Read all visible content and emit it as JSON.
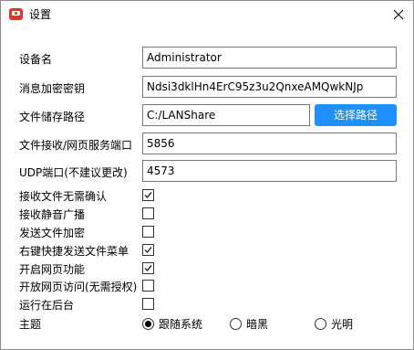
{
  "window": {
    "title": "设置",
    "icon": "app-screen-icon",
    "close_icon": "close-icon"
  },
  "form": {
    "device_name": {
      "label": "设备名",
      "value": "Administrator"
    },
    "encryption_key": {
      "label": "消息加密密钥",
      "value": "Ndsi3dklHn4ErC95z3u2QnxeAMQwkNJp"
    },
    "storage_path": {
      "label": "文件储存路径",
      "value": "C:/LANShare",
      "button": "选择路径"
    },
    "web_port": {
      "label": "文件接收/网页服务端口",
      "value": "5856"
    },
    "udp_port": {
      "label": "UDP端口(不建议更改)",
      "value": "4573"
    }
  },
  "options": [
    {
      "label": "接收文件无需确认",
      "checked": true
    },
    {
      "label": "接收静音广播",
      "checked": false
    },
    {
      "label": "发送文件加密",
      "checked": false
    },
    {
      "label": "右键快捷发送文件菜单",
      "checked": true
    },
    {
      "label": "开启网页功能",
      "checked": true
    },
    {
      "label": "开放网页访问(无需授权)",
      "checked": false
    },
    {
      "label": "运行在后台",
      "checked": false
    }
  ],
  "theme": {
    "label": "主题",
    "options": [
      "跟随系统",
      "暗黑",
      "光明"
    ],
    "selected": "跟随系统"
  }
}
